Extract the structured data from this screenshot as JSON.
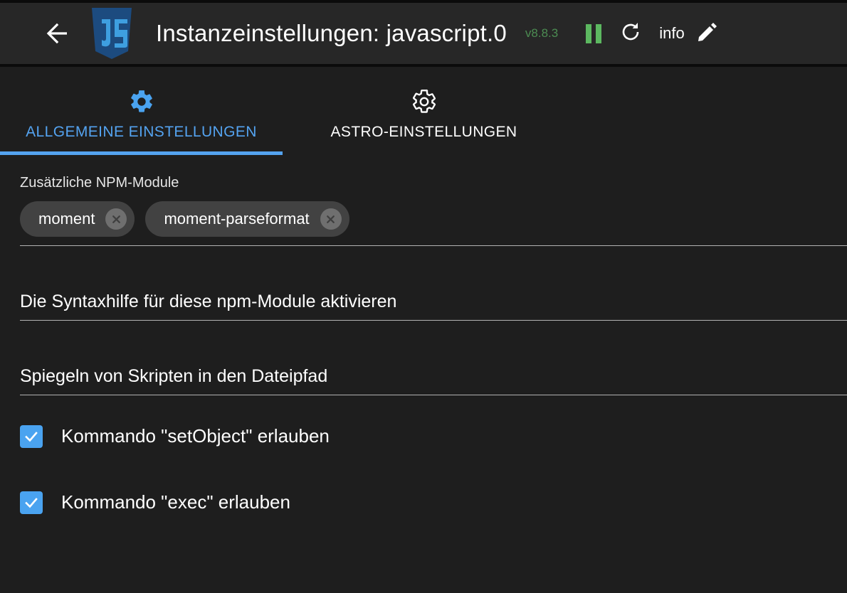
{
  "header": {
    "back_icon": "arrow-left-icon",
    "logo_icon": "javascript-logo-icon",
    "title": "Instanzeinstellungen: javascript.0",
    "version": "v8.8.3",
    "pause_icon": "pause-icon",
    "refresh_icon": "refresh-icon",
    "info_label": "info",
    "edit_icon": "pencil-icon",
    "accent_green": "#5cb860",
    "bar_background": "#272727"
  },
  "tabs": [
    {
      "label": "ALLGEMEINE EINSTELLUNGEN",
      "icon": "gear-filled-icon",
      "active": true,
      "color": "#54a3f0"
    },
    {
      "label": "ASTRO-EINSTELLUNGEN",
      "icon": "gear-outline-icon",
      "active": false,
      "color": "#ffffff"
    }
  ],
  "main": {
    "npm_modules": {
      "label": "Zusätzliche NPM-Module",
      "chips": [
        {
          "label": "moment",
          "remove_icon": "close-circle-icon"
        },
        {
          "label": "moment-parseformat",
          "remove_icon": "close-circle-icon"
        }
      ]
    },
    "fields": [
      {
        "value": "Die Syntaxhilfe für diese npm-Module aktivieren"
      },
      {
        "value": "Spiegeln von Skripten in den Dateipfad"
      }
    ],
    "checkboxes": [
      {
        "label": "Kommando \"setObject\" erlauben",
        "checked": true,
        "check_icon": "check-icon"
      },
      {
        "label": "Kommando \"exec\" erlauben",
        "checked": true,
        "check_icon": "check-icon"
      }
    ],
    "checkbox_color": "#4aa3f0"
  }
}
